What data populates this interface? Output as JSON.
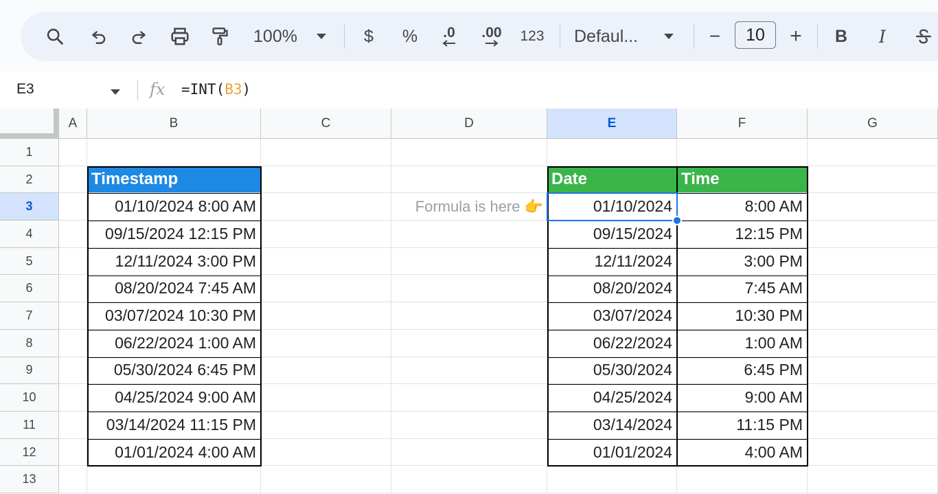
{
  "toolbar": {
    "zoom": "100%",
    "currency": "$",
    "percent": "%",
    "decrease_decimal": ".0",
    "increase_decimal": ".00",
    "more_formats": "123",
    "font": "Defaul...",
    "minus": "−",
    "font_size": "10",
    "plus": "+",
    "bold": "B",
    "italic": "I"
  },
  "formula_bar": {
    "cell_ref": "E3",
    "fx": "fx",
    "formula_prefix": "=INT(",
    "formula_ref": "B3",
    "formula_suffix": ")"
  },
  "columns": [
    "A",
    "B",
    "C",
    "D",
    "E",
    "F",
    "G"
  ],
  "rows": [
    "1",
    "2",
    "3",
    "4",
    "5",
    "6",
    "7",
    "8",
    "9",
    "10",
    "11",
    "12",
    "13"
  ],
  "selected_cell": "E3",
  "sheet": {
    "timestamp_header": "Timestamp",
    "date_header": "Date",
    "time_header": "Time",
    "note": "Formula is here 👉",
    "timestamps": [
      "01/10/2024 8:00 AM",
      "09/15/2024 12:15 PM",
      "12/11/2024 3:00 PM",
      "08/20/2024 7:45 AM",
      "03/07/2024 10:30 PM",
      "06/22/2024 1:00 AM",
      "05/30/2024 6:45 PM",
      "04/25/2024 9:00 AM",
      "03/14/2024 11:15 PM",
      "01/01/2024 4:00 AM"
    ],
    "dates": [
      "01/10/2024",
      "09/15/2024",
      "12/11/2024",
      "08/20/2024",
      "03/07/2024",
      "06/22/2024",
      "05/30/2024",
      "04/25/2024",
      "03/14/2024",
      "01/01/2024"
    ],
    "times": [
      "8:00 AM",
      "12:15 PM",
      "3:00 PM",
      "7:45 AM",
      "10:30 PM",
      "1:00 AM",
      "6:45 PM",
      "9:00 AM",
      "11:15 PM",
      "4:00 AM"
    ]
  },
  "colors": {
    "timestamp_header_bg": "#1e88e5",
    "date_time_header_bg": "#3ab54a",
    "selection": "#1a73e8"
  }
}
